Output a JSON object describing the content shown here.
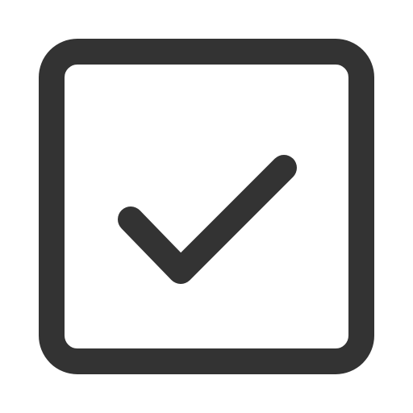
{
  "checkbox": {
    "checked": true,
    "icon": "checkbox-checked-icon",
    "color": "#333333",
    "background": "#ffffff"
  }
}
